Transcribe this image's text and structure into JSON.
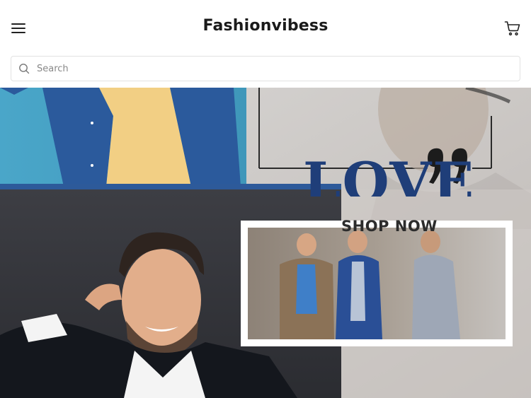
{
  "header": {
    "brand": "Fashionvibess",
    "menu_icon": "hamburger-menu-icon",
    "cart_icon": "shopping-cart-icon"
  },
  "search": {
    "placeholder": "Search",
    "value": "",
    "icon": "search-icon"
  },
  "hero": {
    "headline": "LOVE",
    "cta": "SHOP NOW",
    "quote_mark": "”"
  },
  "colors": {
    "background": "#ffffff",
    "brand_text": "#1a1a1a",
    "headline_blue": "#1f3e79",
    "search_border": "#e2e2e2"
  }
}
